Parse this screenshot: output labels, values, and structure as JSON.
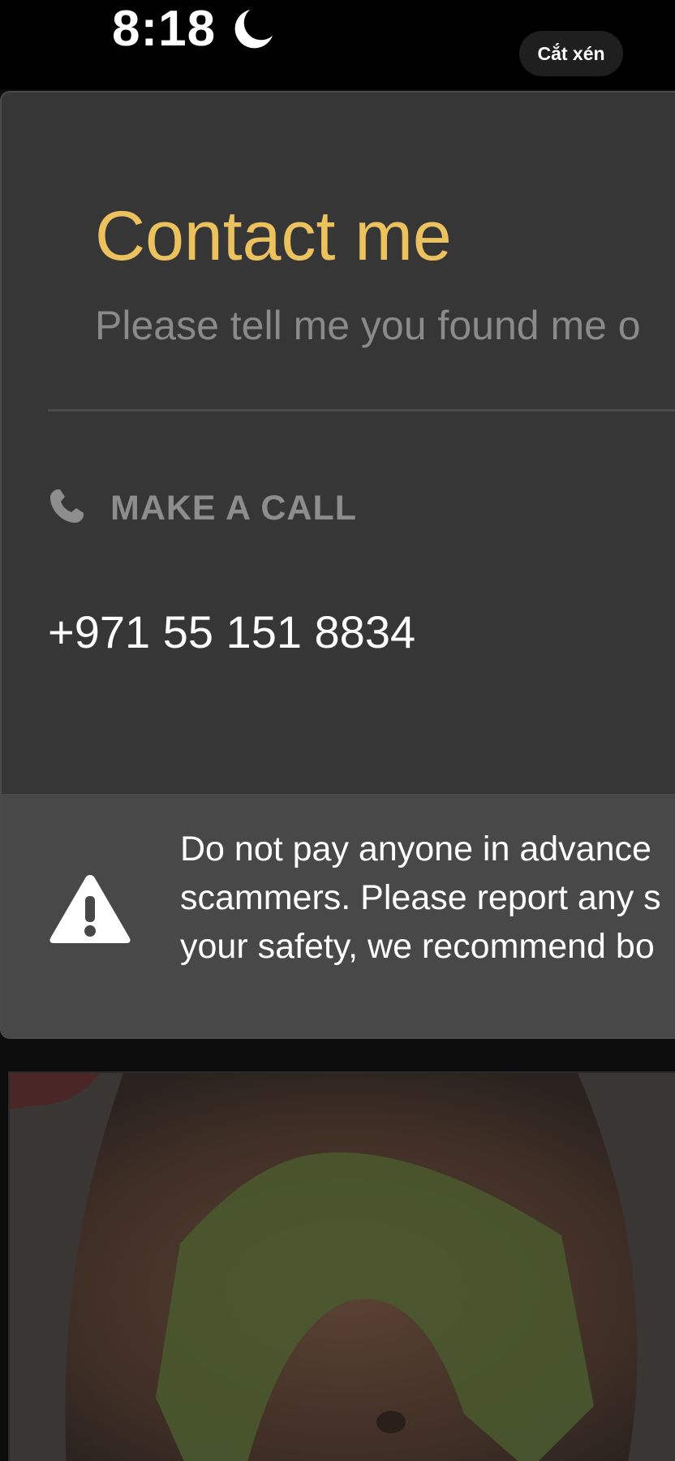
{
  "status_bar": {
    "time": "8:18",
    "focus_icon": "moon-icon"
  },
  "crop_button": {
    "label": "Cắt xén"
  },
  "contact": {
    "title": "Contact me",
    "subtitle": "Please tell me you found me o",
    "call_icon": "phone-icon",
    "call_label": "MAKE A CALL",
    "phone_number": "+971 55 151 8834"
  },
  "warning": {
    "icon": "warning-icon",
    "lines": [
      "Do not pay anyone in advance",
      "scammers. Please report any s",
      "your safety, we recommend bo"
    ]
  },
  "photo": {
    "description_icon": "profile-photo"
  },
  "colors": {
    "accent_title": "#ecc25e",
    "card_background": "#363636",
    "warning_background": "#484848",
    "muted_text": "#8d8d8d"
  }
}
